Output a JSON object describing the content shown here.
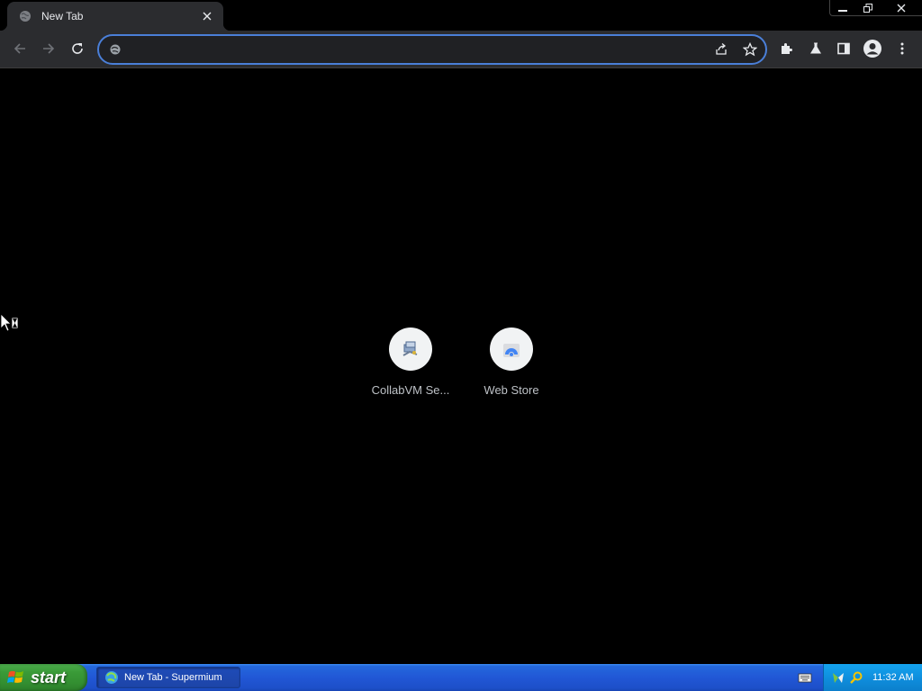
{
  "tab": {
    "title": "New Tab",
    "favicon": "globe-icon"
  },
  "window_controls": [
    "minimize-icon",
    "restore-icon",
    "close-icon"
  ],
  "toolbar": {
    "back_icon": "arrow-left-icon",
    "forward_icon": "arrow-right-icon",
    "reload_icon": "reload-icon",
    "extensions_icon": "puzzle-icon",
    "labs_icon": "flask-icon",
    "side_panel_icon": "side-panel-icon",
    "profile_icon": "account-icon",
    "menu_icon": "kebab-menu-icon"
  },
  "omnibox": {
    "value": "",
    "placeholder": "",
    "accent": "#4a7fd8"
  },
  "shortcuts": [
    {
      "label": "CollabVM Se...",
      "icon": "collabvm-icon"
    },
    {
      "label": "Web Store",
      "icon": "web-store-icon"
    }
  ],
  "taskbar": {
    "start_label": "start",
    "task_label": "New Tab - Supermium",
    "clock": "11:32 AM"
  },
  "colors": {
    "tab_bg": "#2b2c2f",
    "content_bg": "#000000",
    "taskbar_blue": "#2157d6",
    "start_green": "#3a9b38"
  }
}
